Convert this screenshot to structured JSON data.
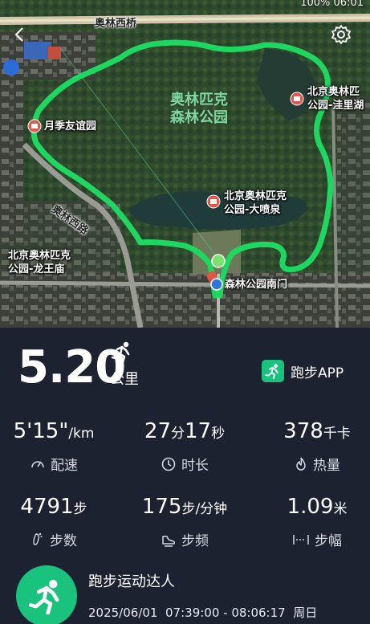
{
  "status": {
    "battery": "100%",
    "time": "06:01"
  },
  "map": {
    "road_top": "奥林西桥",
    "road_diag": "奥林西路",
    "park_name_line1": "奥林匹克",
    "park_name_line2": "森林公园",
    "pois": [
      {
        "line1": "月季友谊园",
        "line2": ""
      },
      {
        "line1": "北京奥林匹克",
        "line2": "公园-大喷泉"
      },
      {
        "line1": "北京奥林匹",
        "line2": "公园-洼里湖"
      },
      {
        "line1": "北京奥林匹克",
        "line2": "公园-龙王庙"
      },
      {
        "line1": "森林公园南门",
        "line2": ""
      }
    ],
    "route_color": "#1ed760",
    "back_icon": "chevron-left-icon",
    "settings_icon": "gear-icon"
  },
  "summary": {
    "distance": "5.20",
    "distance_unit": "公里",
    "app_name": "跑步APP"
  },
  "stats": [
    {
      "value": "5'15\"",
      "unit": "/km",
      "label": "配速",
      "icon": "speedometer-icon"
    },
    {
      "value": "27",
      "unit": "分",
      "value2": "17",
      "unit2": "秒",
      "label": "时长",
      "icon": "clock-icon"
    },
    {
      "value": "378",
      "unit": "千卡",
      "label": "热量",
      "icon": "flame-icon"
    },
    {
      "value": "4791",
      "unit": "步",
      "label": "步数",
      "icon": "footprint-icon"
    },
    {
      "value": "175",
      "unit": "步/分钟",
      "label": "步频",
      "icon": "shoe-icon"
    },
    {
      "value": "1.09",
      "unit": "米",
      "label": "步幅",
      "icon": "stride-icon"
    }
  ],
  "user": {
    "name": "跑步运动达人",
    "date": "2025/06/01",
    "time_range": "07:39:00 - 08:06:17",
    "weekday": "周日"
  },
  "colors": {
    "accent": "#19c37d",
    "panel_bg": "#1d2230",
    "poi_pin": "#e0574f"
  }
}
